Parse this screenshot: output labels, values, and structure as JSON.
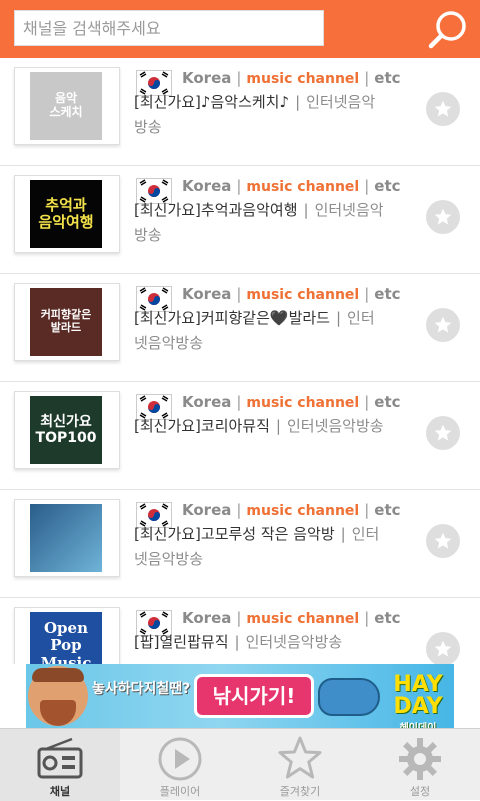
{
  "search": {
    "placeholder": "채널을 검색해주세요"
  },
  "colors": {
    "accent": "#f7703c",
    "channel_text": "#f07135"
  },
  "channels": [
    {
      "thumb_text": "음악\n스케치",
      "thumb_bg": "#c8c8c8",
      "thumb_color": "#ffffff",
      "country": "Korea",
      "tag": "music channel",
      "extra": "etc",
      "name": "[최신가요]♪음악스케치♪",
      "source": "인터넷음악방송"
    },
    {
      "thumb_text": "추억과\n음악여행",
      "thumb_bg": "#050505",
      "thumb_color": "#f3e24a",
      "country": "Korea",
      "tag": "music channel",
      "extra": "etc",
      "name": "[최신가요]추억과음악여행",
      "source": "인터넷음악방송"
    },
    {
      "thumb_text": "커피향같은\n발라드",
      "thumb_bg": "#5a2a25",
      "thumb_color": "#ffffff",
      "country": "Korea",
      "tag": "music channel",
      "extra": "etc",
      "name": "[최신가요]커피향같은🖤발라드",
      "source": "인터넷음악방송"
    },
    {
      "thumb_text": "최신가요\nTOP100",
      "thumb_bg": "#1d3a2a",
      "thumb_color": "#ffffff",
      "country": "Korea",
      "tag": "music channel",
      "extra": "etc",
      "name": "[최신가요]코리아뮤직",
      "source": "인터넷음악방송"
    },
    {
      "thumb_text": "",
      "thumb_bg": "#2d7aa6",
      "thumb_color": "#ffffff",
      "country": "Korea",
      "tag": "music channel",
      "extra": "etc",
      "name": "[최신가요]고모루성 작은 음악방",
      "source": "인터넷음악방송"
    },
    {
      "thumb_text": "Open\nPop\nMusic",
      "thumb_bg": "#1f4fa0",
      "thumb_color": "#ffffff",
      "country": "Korea",
      "tag": "music channel",
      "extra": "etc",
      "name": "[팝]열린팝뮤직",
      "source": "인터넷음악방송"
    }
  ],
  "ad": {
    "text1": "놓사하다지칠땐?",
    "button": "낚시가기!",
    "logo": "HAY DAY",
    "logo_sub": "헤이데이"
  },
  "tabs": [
    {
      "label": "채널",
      "icon": "radio-icon",
      "active": true
    },
    {
      "label": "플레이어",
      "icon": "play-icon",
      "active": false
    },
    {
      "label": "즐겨찾기",
      "icon": "star-icon",
      "active": false
    },
    {
      "label": "설정",
      "icon": "gear-icon",
      "active": false
    }
  ]
}
